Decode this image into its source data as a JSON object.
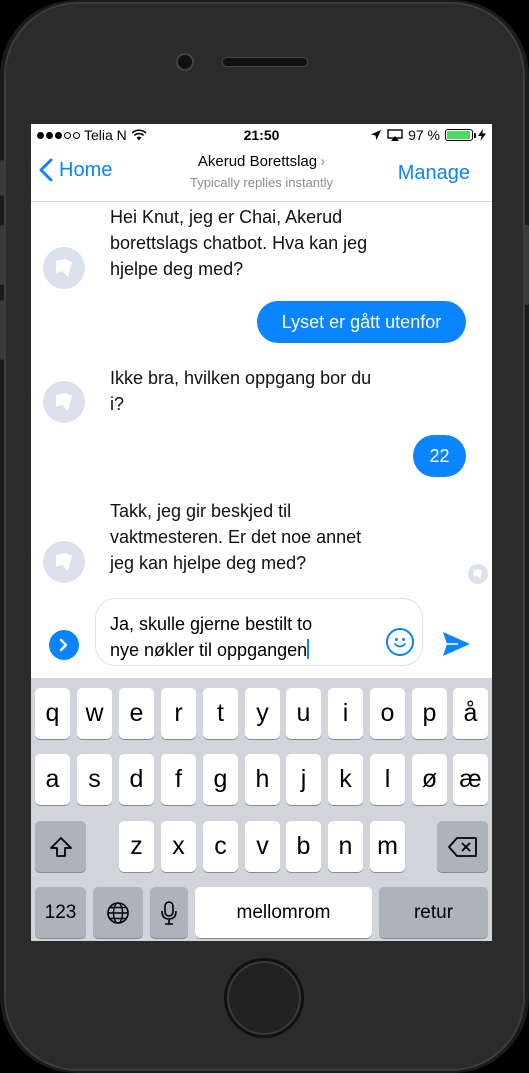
{
  "status_bar": {
    "carrier": "Telia N",
    "time": "21:50",
    "battery_percent": "97 %",
    "battery_level": 0.97
  },
  "nav": {
    "back_label": "Home",
    "title": "Akerud Borettslag",
    "subtitle": "Typically replies instantly",
    "manage_label": "Manage"
  },
  "messages": [
    {
      "from": "bot",
      "lines": [
        "Hei Knut, jeg er Chai, Akerud",
        "borettslags chatbot. Hva kan jeg",
        "hjelpe deg med?"
      ]
    },
    {
      "from": "user",
      "text": "Lyset er gått utenfor"
    },
    {
      "from": "bot",
      "lines": [
        "Ikke bra, hvilken oppgang bor du",
        "i?"
      ]
    },
    {
      "from": "user",
      "text": "22"
    },
    {
      "from": "bot",
      "lines": [
        "Takk, jeg gir beskjed til",
        "vaktmesteren. Er det noe annet",
        "jeg kan hjelpe deg med?"
      ]
    }
  ],
  "composer": {
    "line1": "Ja, skulle gjerne bestilt to",
    "line2": "nye nøkler til oppgangen"
  },
  "keyboard": {
    "row1": [
      "q",
      "w",
      "e",
      "r",
      "t",
      "y",
      "u",
      "i",
      "o",
      "p",
      "å"
    ],
    "row2": [
      "a",
      "s",
      "d",
      "f",
      "g",
      "h",
      "j",
      "k",
      "l",
      "ø",
      "æ"
    ],
    "row3": [
      "z",
      "x",
      "c",
      "v",
      "b",
      "n",
      "m"
    ],
    "numbers_label": "123",
    "space_label": "mellomrom",
    "return_label": "retur"
  },
  "colors": {
    "accent": "#0a84ff",
    "battery": "#4cd964",
    "keyboard_bg": "#d1d5db",
    "avatar_bg": "#dbe1ec"
  },
  "icons": [
    "wifi-icon",
    "location-icon",
    "airplay-icon",
    "charging-icon",
    "chevron-left-icon",
    "chevron-right-icon",
    "bot-avatar-icon",
    "expand-icon",
    "emoji-icon",
    "send-icon",
    "shift-icon",
    "backspace-icon",
    "globe-icon",
    "microphone-icon"
  ]
}
